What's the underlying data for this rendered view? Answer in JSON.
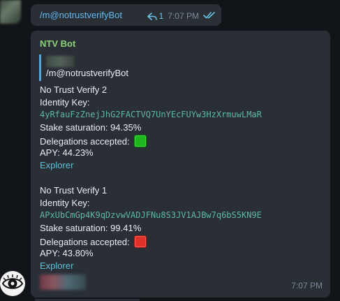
{
  "outgoing": {
    "text": "/m@notrustverifyBot",
    "reply_count": "1",
    "time": "7:07 PM"
  },
  "bot_message": {
    "sender": "NTV Bot",
    "quote_text": "/m@notrustverifyBot",
    "pools": [
      {
        "name": "No Trust Verify 2",
        "identity_label": "Identity Key:",
        "identity_key": "4yRfauFzZnejJhG2FACTVQ7UnYEcFUYw3HzXrmuwLMaR",
        "stake": "Stake saturation: 94.35%",
        "delegations": "Delegations accepted:",
        "delegations_status": "green",
        "apy": "APY: 44.23%",
        "link": "Explorer"
      },
      {
        "name": "No Trust Verify 1",
        "identity_label": "Identity Key:",
        "identity_key": "APxUbCmGp4K9qDzvwVADJFNu8S3JV1AJBw7q6bS5KN9E",
        "stake": "Stake saturation: 99.41%",
        "delegations": "Delegations accepted:",
        "delegations_status": "red",
        "apy": "APY: 43.80%",
        "link": "Explorer"
      }
    ],
    "time": "7:07 PM"
  },
  "colors": {
    "background": "#111418",
    "bubble": "#2a2f36",
    "sender": "#8fd17a",
    "link": "#5fc0d9",
    "mono": "#5fb8a6"
  },
  "icons": [
    "reply-arrow-icon",
    "double-check-icon",
    "square-green-icon",
    "square-red-icon",
    "eye-avatar-icon"
  ]
}
